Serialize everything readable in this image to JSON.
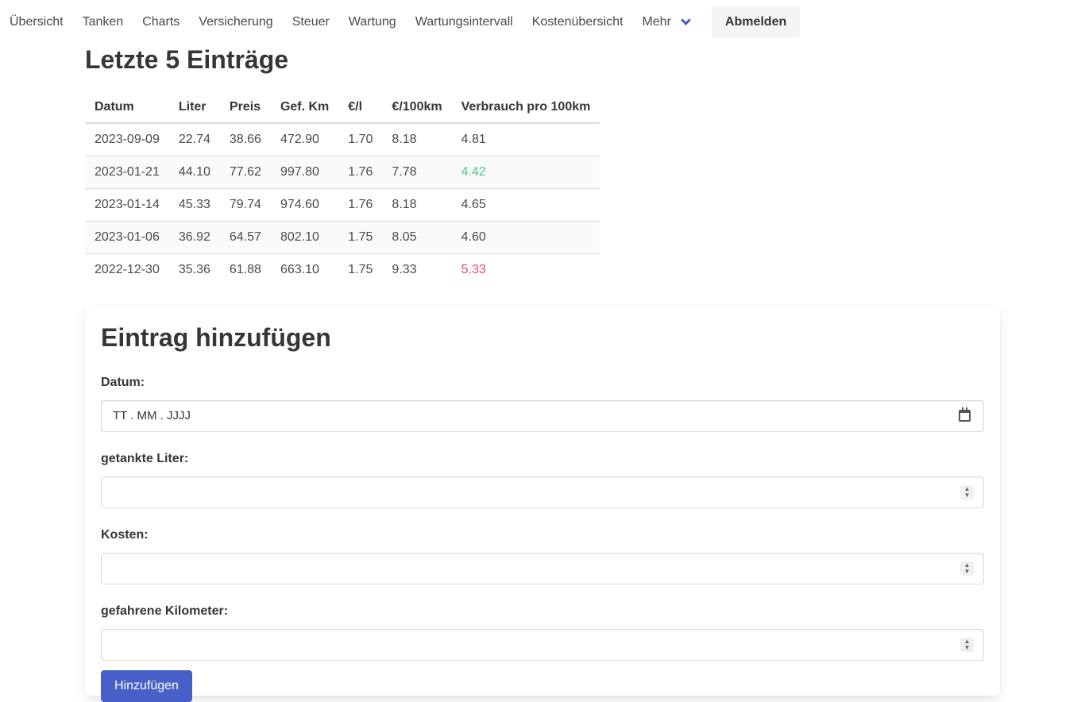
{
  "nav": {
    "items": [
      "Übersicht",
      "Tanken",
      "Charts",
      "Versicherung",
      "Steuer",
      "Wartung",
      "Wartungsintervall",
      "Kostenübersicht"
    ],
    "more_label": "Mehr",
    "logout_label": "Abmelden"
  },
  "recent": {
    "title": "Letzte 5 Einträge",
    "columns": [
      "Datum",
      "Liter",
      "Preis",
      "Gef. Km",
      "€/l",
      "€/100km",
      "Verbrauch pro 100km"
    ],
    "rows": [
      [
        "2023-09-09",
        "22.74",
        "38.66",
        "472.90",
        "1.70",
        "8.18",
        "4.81"
      ],
      [
        "2023-01-21",
        "44.10",
        "77.62",
        "997.80",
        "1.76",
        "7.78",
        "4.42"
      ],
      [
        "2023-01-14",
        "45.33",
        "79.74",
        "974.60",
        "1.76",
        "8.18",
        "4.65"
      ],
      [
        "2023-01-06",
        "36.92",
        "64.57",
        "802.10",
        "1.75",
        "8.05",
        "4.60"
      ],
      [
        "2022-12-30",
        "35.36",
        "61.88",
        "663.10",
        "1.75",
        "9.33",
        "5.33"
      ]
    ]
  },
  "form": {
    "title": "Eintrag hinzufügen",
    "date_label": "Datum:",
    "date_placeholder": "TT . MM . JJJJ",
    "liters_label": "getankte Liter:",
    "cost_label": "Kosten:",
    "km_label": "gefahrene Kilometer:",
    "submit_label": "Hinzufügen"
  },
  "colors": {
    "accent": "#485fc7",
    "good": "#48c78e",
    "bad": "#f14668"
  }
}
